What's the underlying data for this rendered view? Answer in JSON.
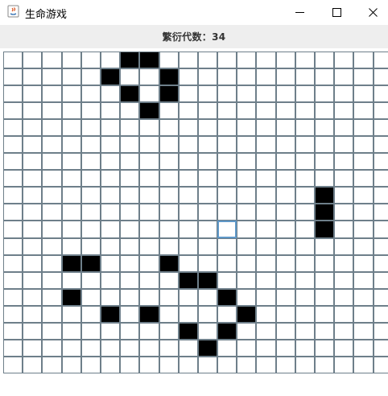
{
  "window": {
    "title": "生命游戏",
    "minimize_symbol": "—",
    "maximize_symbol": "☐",
    "close_symbol": "✕"
  },
  "status": {
    "label": "繁衍代数：",
    "generation": "34"
  },
  "grid": {
    "rows": 19,
    "cols": 20,
    "alive_cells": [
      [
        0,
        6
      ],
      [
        0,
        7
      ],
      [
        1,
        5
      ],
      [
        1,
        8
      ],
      [
        2,
        6
      ],
      [
        2,
        8
      ],
      [
        3,
        7
      ],
      [
        8,
        16
      ],
      [
        9,
        16
      ],
      [
        10,
        16
      ],
      [
        12,
        3
      ],
      [
        12,
        4
      ],
      [
        12,
        8
      ],
      [
        13,
        9
      ],
      [
        13,
        10
      ],
      [
        14,
        3
      ],
      [
        14,
        11
      ],
      [
        15,
        5
      ],
      [
        15,
        7
      ],
      [
        15,
        12
      ],
      [
        16,
        9
      ],
      [
        16,
        11
      ],
      [
        17,
        10
      ]
    ],
    "focused_cell": [
      10,
      11
    ],
    "colors": {
      "alive": "#000000",
      "dead": "#ffffff",
      "grid_line": "#6e7f8a",
      "focus": "#5f98c8"
    }
  }
}
